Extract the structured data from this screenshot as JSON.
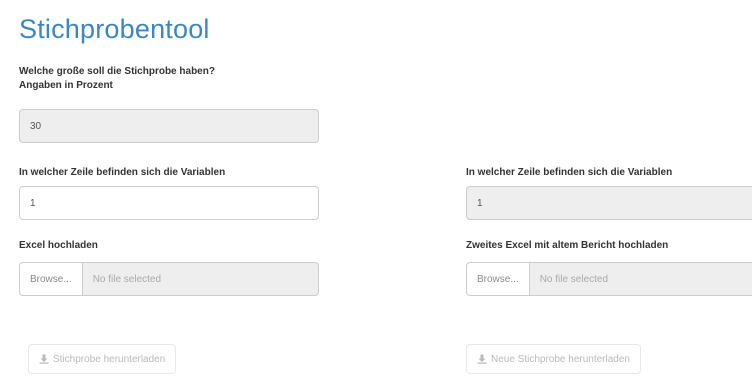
{
  "page": {
    "title": "Stichprobentool"
  },
  "sample_size": {
    "label_line1": "Welche große soll die Stichprobe haben?",
    "label_line2": "Angaben in Prozent",
    "value": "30"
  },
  "row_left": {
    "label": "In welcher Zeile befinden sich die Variablen",
    "value": "1"
  },
  "row_right": {
    "label": "In welcher Zeile befinden sich die Variablen",
    "value": "1"
  },
  "upload_left": {
    "label": "Excel hochladen",
    "browse_label": "Browse...",
    "file_placeholder": "No file selected"
  },
  "upload_right": {
    "label": "Zweites Excel mit altem Bericht hochladen",
    "browse_label": "Browse...",
    "file_placeholder": "No file selected"
  },
  "download_left": {
    "label": "Stichprobe herunterladen",
    "icon": "download-icon"
  },
  "download_right": {
    "label": "Neue Stichprobe herunterladen",
    "icon": "download-icon"
  }
}
